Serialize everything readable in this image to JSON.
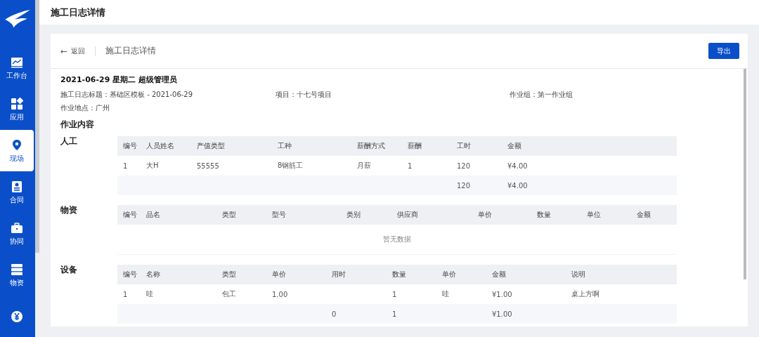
{
  "top_bar": {
    "title": "施工日志详情"
  },
  "sidebar": {
    "items": [
      {
        "label": "工作台",
        "selected": false
      },
      {
        "label": "应用",
        "selected": false
      },
      {
        "label": "现场",
        "selected": true
      },
      {
        "label": "合同",
        "selected": false
      },
      {
        "label": "协同",
        "selected": false
      },
      {
        "label": "物资",
        "selected": false
      },
      {
        "selected": false
      }
    ]
  },
  "card": {
    "back_arrow": "←",
    "back_link": "返回",
    "title": "施工日志详情",
    "export_button": "导出",
    "heading": "2021-06-29 星期二 超级管理员",
    "fields": [
      {
        "label": "施工日志标题：",
        "value": "基础区模板 - 2021-06-29"
      },
      {
        "label": "项目：",
        "value": "十七号项目"
      },
      {
        "label": "作业组：",
        "value": "第一作业组"
      },
      {
        "label": "作业地点：",
        "value": "广州"
      }
    ],
    "section_title": "作业内容",
    "sections": [
      {
        "title": "人工",
        "columns": [
          "编号",
          "人员姓名",
          "产值类型",
          "工种",
          "薪酬方式",
          "薪酬",
          "工时",
          "金额"
        ],
        "rows": [
          [
            "1",
            "大H",
            "55555",
            "8钢筋工",
            "月薪",
            "1",
            "120",
            "¥4.00"
          ],
          [
            null,
            null,
            null,
            null,
            null,
            null,
            "120",
            "¥4.00"
          ]
        ]
      },
      {
        "title": "物资",
        "columns": [
          "编号",
          "品名",
          "类型",
          "型号",
          "类别",
          "供应商",
          "单价",
          "数量",
          "单位",
          "金额"
        ],
        "empty_text": "暂无数据"
      },
      {
        "title": "设备",
        "columns": [
          "编号",
          "名称",
          "类型",
          "单价",
          "用时",
          "数量",
          "单价",
          "金额",
          "说明"
        ],
        "rows": [
          [
            "1",
            "哇",
            "包工",
            "1.00",
            null,
            "1",
            "哇",
            "¥1.00",
            "桌上方啊"
          ],
          [
            null,
            null,
            null,
            null,
            "0",
            "1",
            null,
            "¥1.00",
            null
          ]
        ]
      }
    ]
  }
}
